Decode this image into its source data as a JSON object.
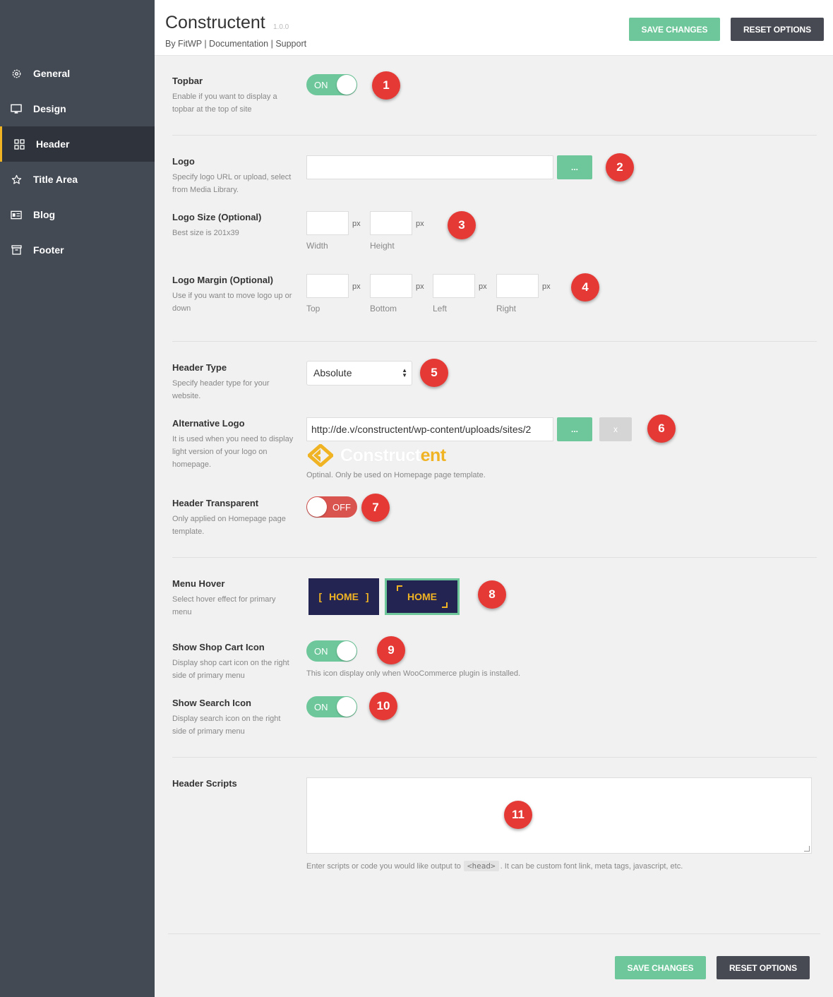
{
  "app": {
    "title": "Constructent",
    "version": "1.0.0",
    "links": "By FitWP | Documentation | Support",
    "save_label": "SAVE CHANGES",
    "reset_label": "RESET OPTIONS"
  },
  "sidebar": {
    "items": [
      {
        "label": "General",
        "icon": "gear-icon"
      },
      {
        "label": "Design",
        "icon": "monitor-icon"
      },
      {
        "label": "Header",
        "icon": "grid-icon",
        "active": true
      },
      {
        "label": "Title Area",
        "icon": "star-icon"
      },
      {
        "label": "Blog",
        "icon": "blog-icon"
      },
      {
        "label": "Footer",
        "icon": "archive-icon"
      }
    ]
  },
  "topbar": {
    "label": "Topbar",
    "desc": "Enable if you want to display a topbar at the top of site",
    "toggle": "ON"
  },
  "logo": {
    "label": "Logo",
    "desc": "Specify logo URL or upload, select from Media Library.",
    "value": "",
    "browse": "..."
  },
  "logo_size": {
    "label": "Logo Size (Optional)",
    "desc": "Best size is 201x39",
    "unit": "px",
    "width_label": "Width",
    "height_label": "Height"
  },
  "logo_margin": {
    "label": "Logo Margin (Optional)",
    "desc": "Use if you want to move logo up or down",
    "unit": "px",
    "top_label": "Top",
    "bottom_label": "Bottom",
    "left_label": "Left",
    "right_label": "Right"
  },
  "header_type": {
    "label": "Header Type",
    "desc": "Specify header type for your website.",
    "selected": "Absolute"
  },
  "alt_logo": {
    "label": "Alternative Logo",
    "desc": "It is used when you need to display light version of your logo on homepage.",
    "value": "http://de.v/constructent/wp-content/uploads/sites/2",
    "browse": "...",
    "clear": "x",
    "preview_text_a": "Construct",
    "preview_text_b": "ent",
    "hint": "Optinal. Only be used on Homepage page template."
  },
  "header_transparent": {
    "label": "Header Transparent",
    "desc": "Only applied on Homepage page template.",
    "toggle": "OFF"
  },
  "menu_hover": {
    "label": "Menu Hover",
    "desc": "Select hover effect for primary menu",
    "option_a": "[ HOME ]",
    "option_b": "HOME"
  },
  "shop_cart": {
    "label": "Show Shop Cart Icon",
    "desc": "Display shop cart icon on the right side of primary menu",
    "toggle": "ON",
    "hint": "This icon display only when WooCommerce plugin is installed."
  },
  "search_icon": {
    "label": "Show Search Icon",
    "desc": "Display search icon on the right side of primary menu",
    "toggle": "ON"
  },
  "header_scripts": {
    "label": "Header Scripts",
    "value": "",
    "hint_before": "Enter scripts or code you would like output to",
    "hint_code": "<head>",
    "hint_after": ". It can be custom font link, meta tags, javascript, etc."
  },
  "badges": [
    "1",
    "2",
    "3",
    "4",
    "5",
    "6",
    "7",
    "8",
    "9",
    "10",
    "11"
  ],
  "colors": {
    "sidebar_bg": "#434a54",
    "active_accent": "#f0b323",
    "save_green": "#6dc79a",
    "reset_dark": "#474a52",
    "toggle_off": "#d9534f",
    "badge_red": "#e53935",
    "menu_navy": "#232452"
  }
}
